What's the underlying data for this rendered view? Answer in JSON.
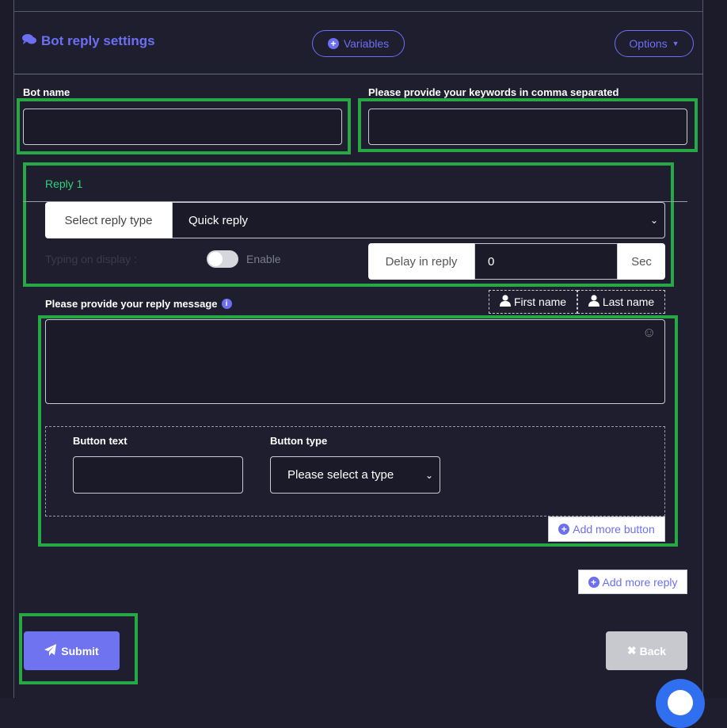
{
  "header": {
    "title": "Bot reply settings",
    "variables_label": "Variables",
    "options_label": "Options"
  },
  "form": {
    "bot_name_label": "Bot name",
    "bot_name_value": "",
    "keywords_label": "Please provide your keywords in comma separated",
    "keywords_value": ""
  },
  "reply": {
    "title": "Reply 1",
    "type_addon": "Select reply type",
    "type_value": "Quick reply",
    "typing_label": "Typing on display :",
    "typing_toggle_label": "Enable",
    "delay_addon": "Delay in reply",
    "delay_value": "0",
    "delay_unit": "Sec",
    "message_label": "Please provide your reply message",
    "first_name_label": "First name",
    "last_name_label": "Last name",
    "button_text_label": "Button text",
    "button_type_label": "Button type",
    "button_type_value": "Please select a type",
    "add_more_button_label": "Add more button"
  },
  "actions": {
    "add_more_reply_label": "Add more reply",
    "submit_label": "Submit",
    "back_label": "Back"
  },
  "colors": {
    "accent": "#6c6ff2",
    "highlight": "#28a745",
    "reply_title": "#2fd17e",
    "background": "#1f1e2e"
  }
}
